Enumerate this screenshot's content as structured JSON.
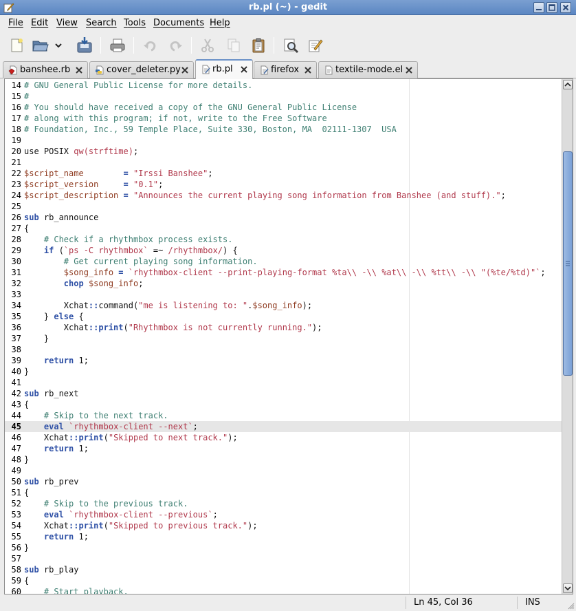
{
  "window": {
    "title": "rb.pl (~) - gedit"
  },
  "menu": [
    {
      "key": "F",
      "rest": "ile"
    },
    {
      "key": "E",
      "rest": "dit"
    },
    {
      "key": "V",
      "rest": "iew"
    },
    {
      "key": "S",
      "rest": "earch"
    },
    {
      "key": "T",
      "rest": "ools"
    },
    {
      "key": "D",
      "rest": "ocuments"
    },
    {
      "key": "H",
      "rest": "elp"
    }
  ],
  "toolbar": {
    "icons": [
      "new-document-icon",
      "open-folder-icon",
      "recent-dropdown-icon",
      "save-icon",
      "print-icon",
      "undo-icon",
      "redo-icon",
      "cut-icon",
      "copy-icon",
      "paste-icon",
      "find-icon",
      "replace-icon"
    ]
  },
  "tabs": [
    {
      "label": "banshee.rb",
      "icon": "ruby-file-icon",
      "active": false
    },
    {
      "label": "cover_deleter.py",
      "icon": "python-file-icon",
      "active": false
    },
    {
      "label": "rb.pl",
      "icon": "text-file-icon",
      "active": true
    },
    {
      "label": "firefox",
      "icon": "text-file-icon",
      "active": false
    },
    {
      "label": "textile-mode.el",
      "icon": "text-file-icon",
      "active": false
    }
  ],
  "editor": {
    "current_line": 45,
    "lines": [
      {
        "n": 14,
        "parts": [
          [
            "c",
            "# GNU General Public License for more details."
          ]
        ]
      },
      {
        "n": 15,
        "parts": [
          [
            "c",
            "#"
          ]
        ]
      },
      {
        "n": 16,
        "parts": [
          [
            "c",
            "# You should have received a copy of the GNU General Public License"
          ]
        ]
      },
      {
        "n": 17,
        "parts": [
          [
            "c",
            "# along with this program; if not, write to the Free Software"
          ]
        ]
      },
      {
        "n": 18,
        "parts": [
          [
            "c",
            "# Foundation, Inc., 59 Temple Place, Suite 330, Boston, MA  02111-1307  USA"
          ]
        ]
      },
      {
        "n": 19,
        "parts": []
      },
      {
        "n": 20,
        "parts": [
          [
            "p",
            "use POSIX "
          ],
          [
            "s",
            "qw(strftime)"
          ],
          [
            "p",
            ";"
          ]
        ]
      },
      {
        "n": 21,
        "parts": []
      },
      {
        "n": 22,
        "parts": [
          [
            "v",
            "$script_name"
          ],
          [
            "p",
            "        "
          ],
          [
            "k",
            "="
          ],
          [
            "p",
            " "
          ],
          [
            "s",
            "\"Irssi Banshee\""
          ],
          [
            "p",
            ";"
          ]
        ]
      },
      {
        "n": 23,
        "parts": [
          [
            "v",
            "$script_version"
          ],
          [
            "p",
            "     "
          ],
          [
            "k",
            "="
          ],
          [
            "p",
            " "
          ],
          [
            "s",
            "\"0.1\""
          ],
          [
            "p",
            ";"
          ]
        ]
      },
      {
        "n": 24,
        "parts": [
          [
            "v",
            "$script_description"
          ],
          [
            "p",
            " "
          ],
          [
            "k",
            "="
          ],
          [
            "p",
            " "
          ],
          [
            "s",
            "\"Announces the current playing song information from Banshee (and stuff).\""
          ],
          [
            "p",
            ";"
          ]
        ]
      },
      {
        "n": 25,
        "parts": []
      },
      {
        "n": 26,
        "parts": [
          [
            "k",
            "sub"
          ],
          [
            "p",
            " rb_announce"
          ]
        ]
      },
      {
        "n": 27,
        "parts": [
          [
            "p",
            "{"
          ]
        ]
      },
      {
        "n": 28,
        "parts": [
          [
            "p",
            "    "
          ],
          [
            "c",
            "# Check if a rhythmbox process exists."
          ]
        ]
      },
      {
        "n": 29,
        "parts": [
          [
            "p",
            "    "
          ],
          [
            "k",
            "if"
          ],
          [
            "p",
            " ("
          ],
          [
            "s",
            "`ps -C rhythmbox`"
          ],
          [
            "p",
            " =~ "
          ],
          [
            "s",
            "/rhythmbox/"
          ],
          [
            "p",
            ") {"
          ]
        ]
      },
      {
        "n": 30,
        "parts": [
          [
            "p",
            "        "
          ],
          [
            "c",
            "# Get current playing song information."
          ]
        ]
      },
      {
        "n": 31,
        "parts": [
          [
            "p",
            "        "
          ],
          [
            "v",
            "$song_info"
          ],
          [
            "p",
            " "
          ],
          [
            "k",
            "="
          ],
          [
            "p",
            " "
          ],
          [
            "s",
            "`rhythmbox-client --print-playing-format %ta\\\\ -\\\\ %at\\\\ -\\\\ %tt\\\\ -\\\\ \"(%te/%td)\"`"
          ],
          [
            "p",
            ";"
          ]
        ]
      },
      {
        "n": 32,
        "parts": [
          [
            "p",
            "        "
          ],
          [
            "k",
            "chop"
          ],
          [
            "p",
            " "
          ],
          [
            "v",
            "$song_info"
          ],
          [
            "p",
            ";"
          ]
        ]
      },
      {
        "n": 33,
        "parts": []
      },
      {
        "n": 34,
        "parts": [
          [
            "p",
            "        Xchat"
          ],
          [
            "k",
            "::"
          ],
          [
            "p",
            "command("
          ],
          [
            "s",
            "\"me is listening to: \""
          ],
          [
            "p",
            "."
          ],
          [
            "v",
            "$song_info"
          ],
          [
            "p",
            ");"
          ]
        ]
      },
      {
        "n": 35,
        "parts": [
          [
            "p",
            "    } "
          ],
          [
            "k",
            "else"
          ],
          [
            "p",
            " {"
          ]
        ]
      },
      {
        "n": 36,
        "parts": [
          [
            "p",
            "        Xchat"
          ],
          [
            "k",
            "::print"
          ],
          [
            "p",
            "("
          ],
          [
            "s",
            "\"Rhythmbox is not currently running.\""
          ],
          [
            "p",
            ");"
          ]
        ]
      },
      {
        "n": 37,
        "parts": [
          [
            "p",
            "    }"
          ]
        ]
      },
      {
        "n": 38,
        "parts": []
      },
      {
        "n": 39,
        "parts": [
          [
            "p",
            "    "
          ],
          [
            "k",
            "return"
          ],
          [
            "p",
            " 1;"
          ]
        ]
      },
      {
        "n": 40,
        "parts": [
          [
            "p",
            "}"
          ]
        ]
      },
      {
        "n": 41,
        "parts": []
      },
      {
        "n": 42,
        "parts": [
          [
            "k",
            "sub"
          ],
          [
            "p",
            " rb_next"
          ]
        ]
      },
      {
        "n": 43,
        "parts": [
          [
            "p",
            "{"
          ]
        ]
      },
      {
        "n": 44,
        "parts": [
          [
            "p",
            "    "
          ],
          [
            "c",
            "# Skip to the next track."
          ]
        ]
      },
      {
        "n": 45,
        "parts": [
          [
            "p",
            "    "
          ],
          [
            "k",
            "eval"
          ],
          [
            "p",
            " "
          ],
          [
            "s",
            "`rhythmbox-client --next`"
          ],
          [
            "p",
            ";"
          ]
        ]
      },
      {
        "n": 46,
        "parts": [
          [
            "p",
            "    Xchat"
          ],
          [
            "k",
            "::print"
          ],
          [
            "p",
            "("
          ],
          [
            "s",
            "\"Skipped to next track.\""
          ],
          [
            "p",
            ");"
          ]
        ]
      },
      {
        "n": 47,
        "parts": [
          [
            "p",
            "    "
          ],
          [
            "k",
            "return"
          ],
          [
            "p",
            " 1;"
          ]
        ]
      },
      {
        "n": 48,
        "parts": [
          [
            "p",
            "}"
          ]
        ]
      },
      {
        "n": 49,
        "parts": []
      },
      {
        "n": 50,
        "parts": [
          [
            "k",
            "sub"
          ],
          [
            "p",
            " rb_prev"
          ]
        ]
      },
      {
        "n": 51,
        "parts": [
          [
            "p",
            "{"
          ]
        ]
      },
      {
        "n": 52,
        "parts": [
          [
            "p",
            "    "
          ],
          [
            "c",
            "# Skip to the previous track."
          ]
        ]
      },
      {
        "n": 53,
        "parts": [
          [
            "p",
            "    "
          ],
          [
            "k",
            "eval"
          ],
          [
            "p",
            " "
          ],
          [
            "s",
            "`rhythmbox-client --previous`"
          ],
          [
            "p",
            ";"
          ]
        ]
      },
      {
        "n": 54,
        "parts": [
          [
            "p",
            "    Xchat"
          ],
          [
            "k",
            "::print"
          ],
          [
            "p",
            "("
          ],
          [
            "s",
            "\"Skipped to previous track.\""
          ],
          [
            "p",
            ");"
          ]
        ]
      },
      {
        "n": 55,
        "parts": [
          [
            "p",
            "    "
          ],
          [
            "k",
            "return"
          ],
          [
            "p",
            " 1;"
          ]
        ]
      },
      {
        "n": 56,
        "parts": [
          [
            "p",
            "}"
          ]
        ]
      },
      {
        "n": 57,
        "parts": []
      },
      {
        "n": 58,
        "parts": [
          [
            "k",
            "sub"
          ],
          [
            "p",
            " rb_play"
          ]
        ]
      },
      {
        "n": 59,
        "parts": [
          [
            "p",
            "{"
          ]
        ]
      },
      {
        "n": 60,
        "parts": [
          [
            "p",
            "    "
          ],
          [
            "c",
            "# Start playback."
          ]
        ]
      }
    ]
  },
  "status": {
    "position": "Ln 45, Col 36",
    "mode": "INS"
  },
  "colors": {
    "comment": "#3e7f72",
    "string": "#b0384b",
    "keyword": "#2f51a6",
    "variable": "#8e3a1f",
    "titlebar": "#6a93cb"
  }
}
